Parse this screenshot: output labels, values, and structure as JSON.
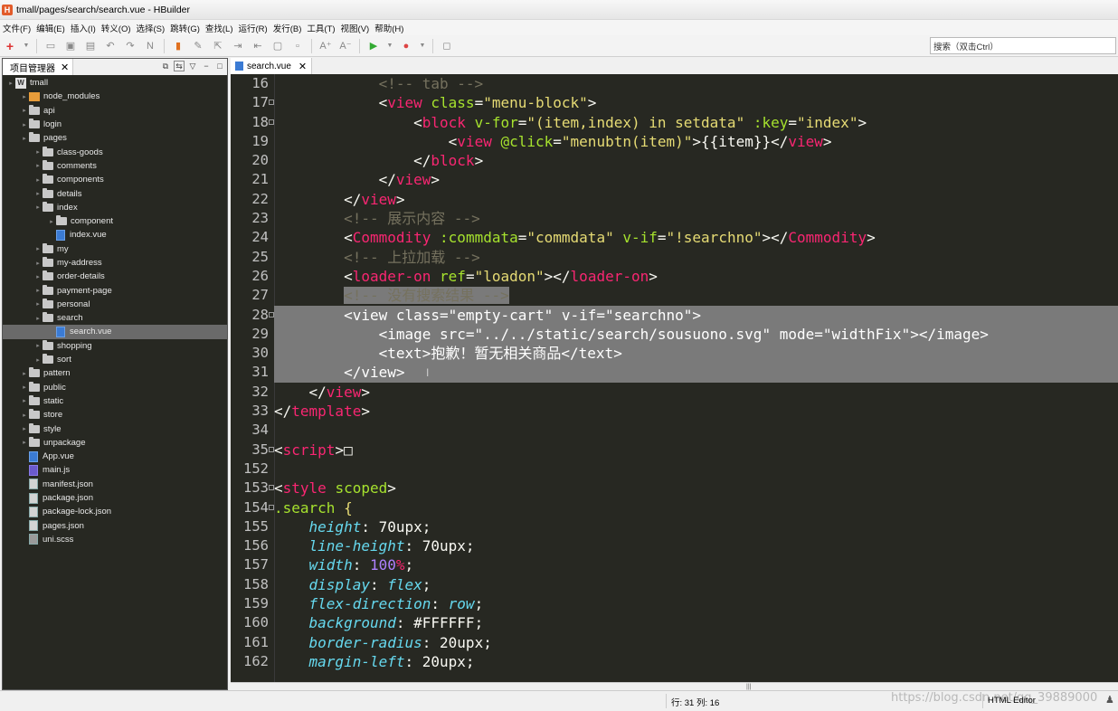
{
  "window": {
    "title": "tmall/pages/search/search.vue  -  HBuilder",
    "logo_letter": "H"
  },
  "menu": [
    "文件(F)",
    "编辑(E)",
    "插入(I)",
    "转义(O)",
    "选择(S)",
    "跳转(G)",
    "查找(L)",
    "运行(R)",
    "发行(B)",
    "工具(T)",
    "视图(V)",
    "帮助(H)"
  ],
  "toolbar": {
    "search_placeholder": "搜索（双击Ctrl）"
  },
  "project_panel": {
    "tab_label": "项目管理器",
    "close": "✕",
    "tree": [
      {
        "label": "tmall",
        "type": "project",
        "indent": 0
      },
      {
        "label": "node_modules",
        "type": "nm",
        "indent": 1
      },
      {
        "label": "api",
        "type": "folder",
        "indent": 1
      },
      {
        "label": "login",
        "type": "folder",
        "indent": 1
      },
      {
        "label": "pages",
        "type": "folder",
        "indent": 1
      },
      {
        "label": "class-goods",
        "type": "folder",
        "indent": 2
      },
      {
        "label": "comments",
        "type": "folder",
        "indent": 2
      },
      {
        "label": "components",
        "type": "folder",
        "indent": 2
      },
      {
        "label": "details",
        "type": "folder",
        "indent": 2
      },
      {
        "label": "index",
        "type": "folder",
        "indent": 2
      },
      {
        "label": "component",
        "type": "folder",
        "indent": 3
      },
      {
        "label": "index.vue",
        "type": "vue",
        "indent": 3
      },
      {
        "label": "my",
        "type": "folder",
        "indent": 2
      },
      {
        "label": "my-address",
        "type": "folder",
        "indent": 2
      },
      {
        "label": "order-details",
        "type": "folder",
        "indent": 2
      },
      {
        "label": "payment-page",
        "type": "folder",
        "indent": 2
      },
      {
        "label": "personal",
        "type": "folder",
        "indent": 2
      },
      {
        "label": "search",
        "type": "folder",
        "indent": 2
      },
      {
        "label": "search.vue",
        "type": "vue",
        "indent": 3,
        "selected": true
      },
      {
        "label": "shopping",
        "type": "folder",
        "indent": 2
      },
      {
        "label": "sort",
        "type": "folder",
        "indent": 2
      },
      {
        "label": "pattern",
        "type": "folder",
        "indent": 1
      },
      {
        "label": "public",
        "type": "folder",
        "indent": 1
      },
      {
        "label": "static",
        "type": "folder",
        "indent": 1
      },
      {
        "label": "store",
        "type": "folder",
        "indent": 1
      },
      {
        "label": "style",
        "type": "folder",
        "indent": 1
      },
      {
        "label": "unpackage",
        "type": "folder",
        "indent": 1
      },
      {
        "label": "App.vue",
        "type": "vue",
        "indent": 1
      },
      {
        "label": "main.js",
        "type": "js",
        "indent": 1
      },
      {
        "label": "manifest.json",
        "type": "json",
        "indent": 1
      },
      {
        "label": "package.json",
        "type": "json",
        "indent": 1
      },
      {
        "label": "package-lock.json",
        "type": "json",
        "indent": 1
      },
      {
        "label": "pages.json",
        "type": "json",
        "indent": 1
      },
      {
        "label": "uni.scss",
        "type": "scss",
        "indent": 1
      }
    ]
  },
  "editor": {
    "tab_label": "search.vue",
    "lines": [
      {
        "n": "16",
        "fold": false,
        "hl": "",
        "tokens": [
          [
            "w",
            "            "
          ],
          [
            "c",
            "<!-- tab -->"
          ]
        ]
      },
      {
        "n": "17",
        "fold": true,
        "hl": "",
        "tokens": [
          [
            "w",
            "            <"
          ],
          [
            "t",
            "view"
          ],
          [
            "a",
            " class"
          ],
          [
            "w",
            "="
          ],
          [
            "s",
            "\"menu-block\""
          ],
          [
            "w",
            ">"
          ]
        ]
      },
      {
        "n": "18",
        "fold": true,
        "hl": "",
        "tokens": [
          [
            "w",
            "                <"
          ],
          [
            "t",
            "block"
          ],
          [
            "a",
            " v-for"
          ],
          [
            "w",
            "="
          ],
          [
            "s",
            "\"(item,index) in setdata\""
          ],
          [
            "a",
            " :key"
          ],
          [
            "w",
            "="
          ],
          [
            "s",
            "\"index\""
          ],
          [
            "w",
            ">"
          ]
        ]
      },
      {
        "n": "19",
        "fold": false,
        "hl": "",
        "tokens": [
          [
            "w",
            "                    <"
          ],
          [
            "t",
            "view"
          ],
          [
            "a",
            " @click"
          ],
          [
            "w",
            "="
          ],
          [
            "s",
            "\"menubtn(item)\""
          ],
          [
            "w",
            ">{{item}}</"
          ],
          [
            "t",
            "view"
          ],
          [
            "w",
            ">"
          ]
        ]
      },
      {
        "n": "20",
        "fold": false,
        "hl": "",
        "tokens": [
          [
            "w",
            "                </"
          ],
          [
            "t",
            "block"
          ],
          [
            "w",
            ">"
          ]
        ]
      },
      {
        "n": "21",
        "fold": false,
        "hl": "",
        "tokens": [
          [
            "w",
            "            </"
          ],
          [
            "t",
            "view"
          ],
          [
            "w",
            ">"
          ]
        ]
      },
      {
        "n": "22",
        "fold": false,
        "hl": "",
        "tokens": [
          [
            "w",
            "        </"
          ],
          [
            "t",
            "view"
          ],
          [
            "w",
            ">"
          ]
        ]
      },
      {
        "n": "23",
        "fold": false,
        "hl": "",
        "tokens": [
          [
            "w",
            "        "
          ],
          [
            "c",
            "<!-- 展示内容 -->"
          ]
        ]
      },
      {
        "n": "24",
        "fold": false,
        "hl": "",
        "tokens": [
          [
            "w",
            "        <"
          ],
          [
            "t",
            "Commodity"
          ],
          [
            "a",
            " :commdata"
          ],
          [
            "w",
            "="
          ],
          [
            "s",
            "\"commdata\""
          ],
          [
            "a",
            " v-if"
          ],
          [
            "w",
            "="
          ],
          [
            "s",
            "\"!searchno\""
          ],
          [
            "w",
            "></"
          ],
          [
            "t",
            "Commodity"
          ],
          [
            "w",
            ">"
          ]
        ]
      },
      {
        "n": "25",
        "fold": false,
        "hl": "",
        "tokens": [
          [
            "w",
            "        "
          ],
          [
            "c",
            "<!-- 上拉加载 -->"
          ]
        ]
      },
      {
        "n": "26",
        "fold": false,
        "hl": "",
        "tokens": [
          [
            "w",
            "        <"
          ],
          [
            "t",
            "loader-on"
          ],
          [
            "a",
            " ref"
          ],
          [
            "w",
            "="
          ],
          [
            "s",
            "\"loadon\""
          ],
          [
            "w",
            "></"
          ],
          [
            "t",
            "loader-on"
          ],
          [
            "w",
            ">"
          ]
        ]
      },
      {
        "n": "27",
        "fold": false,
        "hl": "part",
        "tokens": [
          [
            "w",
            "        "
          ],
          [
            "c",
            "<!-- 没有搜索结果 -->"
          ]
        ]
      },
      {
        "n": "28",
        "fold": true,
        "hl": "line",
        "tokens": [
          [
            "w",
            "        <view class=\"empty-cart\" v-if=\"searchno\">"
          ]
        ]
      },
      {
        "n": "29",
        "fold": false,
        "hl": "line",
        "tokens": [
          [
            "w",
            "            <image src=\"../../static/search/sousuono.svg\" mode=\"widthFix\"></image>"
          ]
        ]
      },
      {
        "n": "30",
        "fold": false,
        "hl": "line",
        "tokens": [
          [
            "w",
            "            <text>抱歉！暂无相关商品</text>"
          ]
        ]
      },
      {
        "n": "31",
        "fold": false,
        "hl": "line",
        "tokens": [
          [
            "w",
            "        </view>"
          ]
        ]
      },
      {
        "n": "32",
        "fold": false,
        "hl": "",
        "tokens": [
          [
            "w",
            "    </"
          ],
          [
            "t",
            "view"
          ],
          [
            "w",
            ">"
          ]
        ]
      },
      {
        "n": "33",
        "fold": false,
        "hl": "",
        "tokens": [
          [
            "w",
            "</"
          ],
          [
            "t",
            "template"
          ],
          [
            "w",
            ">"
          ]
        ]
      },
      {
        "n": "34",
        "fold": false,
        "hl": "",
        "tokens": [
          [
            "w",
            ""
          ]
        ]
      },
      {
        "n": "35",
        "fold": true,
        "hl": "",
        "tokens": [
          [
            "w",
            "<"
          ],
          [
            "t",
            "script"
          ],
          [
            "w",
            ">□"
          ]
        ]
      },
      {
        "n": "152",
        "fold": false,
        "hl": "",
        "tokens": [
          [
            "w",
            ""
          ]
        ]
      },
      {
        "n": "153",
        "fold": true,
        "hl": "",
        "tokens": [
          [
            "w",
            "<"
          ],
          [
            "t",
            "style"
          ],
          [
            "a",
            " scoped"
          ],
          [
            "w",
            ">"
          ]
        ]
      },
      {
        "n": "154",
        "fold": true,
        "hl": "",
        "tokens": [
          [
            "a",
            ".search"
          ],
          [
            "w",
            " "
          ],
          [
            "s",
            "{"
          ]
        ]
      },
      {
        "n": "155",
        "fold": false,
        "hl": "",
        "tokens": [
          [
            "w",
            "    "
          ],
          [
            "p",
            "height"
          ],
          [
            "w",
            ": 70upx;"
          ]
        ]
      },
      {
        "n": "156",
        "fold": false,
        "hl": "",
        "tokens": [
          [
            "w",
            "    "
          ],
          [
            "p",
            "line-height"
          ],
          [
            "w",
            ": 70upx;"
          ]
        ]
      },
      {
        "n": "157",
        "fold": false,
        "hl": "",
        "tokens": [
          [
            "w",
            "    "
          ],
          [
            "p",
            "width"
          ],
          [
            "w",
            ": "
          ],
          [
            "n",
            "100"
          ],
          [
            "t",
            "%"
          ],
          [
            "w",
            ";"
          ]
        ]
      },
      {
        "n": "158",
        "fold": false,
        "hl": "",
        "tokens": [
          [
            "w",
            "    "
          ],
          [
            "p",
            "display"
          ],
          [
            "w",
            ": "
          ],
          [
            "p",
            "flex"
          ],
          [
            "w",
            ";"
          ]
        ]
      },
      {
        "n": "159",
        "fold": false,
        "hl": "",
        "tokens": [
          [
            "w",
            "    "
          ],
          [
            "p",
            "flex-direction"
          ],
          [
            "w",
            ": "
          ],
          [
            "p",
            "row"
          ],
          [
            "w",
            ";"
          ]
        ]
      },
      {
        "n": "160",
        "fold": false,
        "hl": "",
        "tokens": [
          [
            "w",
            "    "
          ],
          [
            "p",
            "background"
          ],
          [
            "w",
            ": "
          ],
          [
            "w",
            "#FFFFFF"
          ],
          [
            "w",
            ";"
          ]
        ]
      },
      {
        "n": "161",
        "fold": false,
        "hl": "",
        "tokens": [
          [
            "w",
            "    "
          ],
          [
            "p",
            "border-radius"
          ],
          [
            "w",
            ": 20upx;"
          ]
        ]
      },
      {
        "n": "162",
        "fold": false,
        "hl": "",
        "tokens": [
          [
            "w",
            "    "
          ],
          [
            "p",
            "margin-left"
          ],
          [
            "w",
            ": 20upx;"
          ]
        ]
      }
    ]
  },
  "statusbar": {
    "position": "行: 31 列: 16",
    "editor_type": "HTML Editor",
    "watermark": "https://blog.csdn.net/qq_39889000"
  }
}
